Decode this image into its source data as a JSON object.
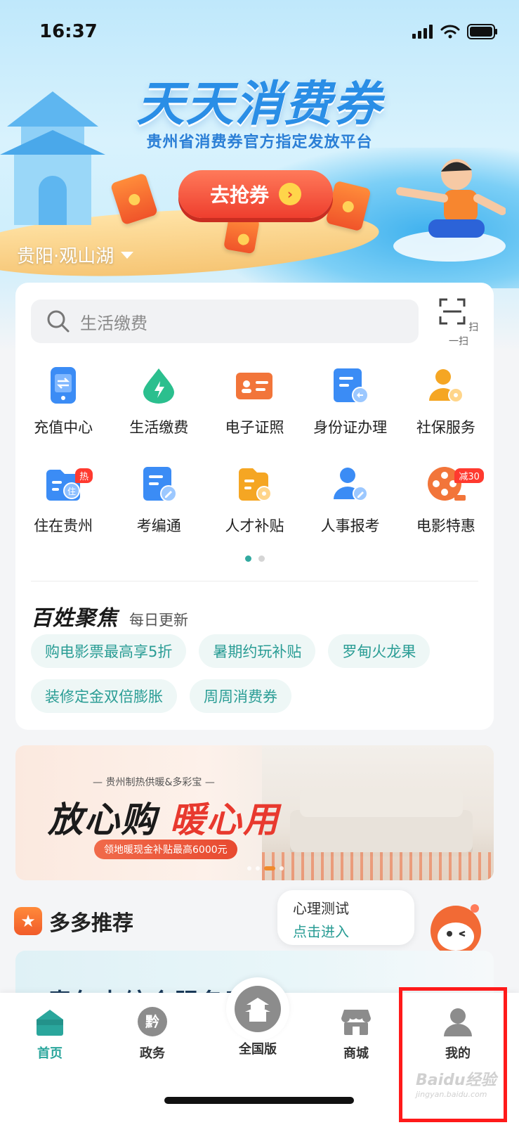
{
  "status_bar": {
    "time": "16:37"
  },
  "banner": {
    "title": "天天消费券",
    "subtitle": "贵州省消费券官方指定发放平台",
    "cta_label": "去抢券",
    "location": "贵阳·观山湖"
  },
  "search": {
    "placeholder": "生活缴费",
    "scan_label": "扫一扫"
  },
  "services": [
    {
      "label": "充值中心",
      "icon": "phone-recharge-icon",
      "color": "#3b8cf5"
    },
    {
      "label": "生活缴费",
      "icon": "utility-drop-icon",
      "color": "#2bbf8e"
    },
    {
      "label": "电子证照",
      "icon": "id-card-icon",
      "color": "#f2753a"
    },
    {
      "label": "身份证办理",
      "icon": "id-document-icon",
      "color": "#3b8cf5"
    },
    {
      "label": "社保服务",
      "icon": "social-security-icon",
      "color": "#f5a623"
    },
    {
      "label": "住在贵州",
      "icon": "housing-icon",
      "color": "#3b8cf5",
      "tag": "热"
    },
    {
      "label": "考编通",
      "icon": "exam-icon",
      "color": "#3b8cf5"
    },
    {
      "label": "人才补贴",
      "icon": "talent-subsidy-icon",
      "color": "#f5a623"
    },
    {
      "label": "人事报考",
      "icon": "personnel-exam-icon",
      "color": "#3b8cf5"
    },
    {
      "label": "电影特惠",
      "icon": "film-reel-icon",
      "color": "#f2753a",
      "tag": "减30"
    }
  ],
  "focus": {
    "title": "百姓聚焦",
    "subtitle": "每日更新",
    "chips": [
      "购电影票最高享5折",
      "暑期约玩补贴",
      "罗甸火龙果",
      "装修定金双倍膨胀",
      "周周消费券"
    ]
  },
  "ad": {
    "kicker": "— 贵州制热供暖&多彩宝 —",
    "headline_a": "放心购",
    "headline_b": "暖心用",
    "pill": "领地暖现金补贴最高6000元"
  },
  "recommend": {
    "title": "多多推荐",
    "bubble_line1": "心理测试",
    "bubble_line2": "点击进入",
    "card_text": "青年占综合服务平"
  },
  "tabs": [
    {
      "label": "首页",
      "icon": "home-icon",
      "active": true
    },
    {
      "label": "政务",
      "icon": "government-icon",
      "active": false
    },
    {
      "label": "全国版",
      "icon": "pavilion-icon",
      "active": false
    },
    {
      "label": "商城",
      "icon": "store-icon",
      "active": false
    },
    {
      "label": "我的",
      "icon": "profile-icon",
      "active": false
    }
  ],
  "colors": {
    "accent": "#2aa69c",
    "highlight_box": "#ff1a1a"
  },
  "watermark": {
    "brand": "Baidu经验",
    "url": "jingyan.baidu.com"
  }
}
